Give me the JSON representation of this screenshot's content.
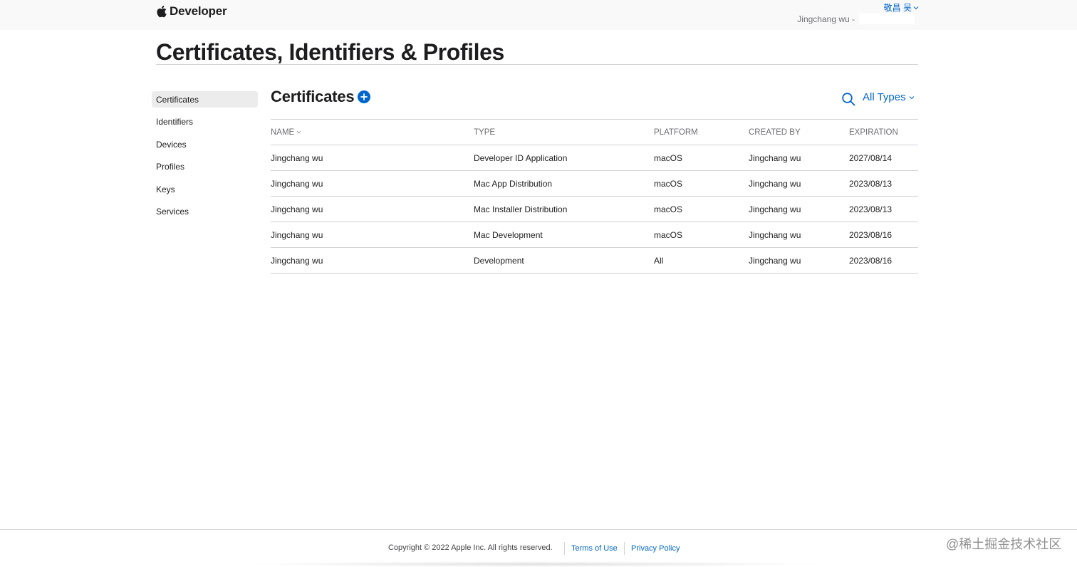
{
  "header": {
    "brand": "Developer",
    "user_name": "敬昌 吴",
    "account_label": "Jingchang wu -"
  },
  "page": {
    "title": "Certificates, Identifiers & Profiles"
  },
  "sidebar": {
    "items": [
      {
        "label": "Certificates",
        "active": true
      },
      {
        "label": "Identifiers"
      },
      {
        "label": "Devices"
      },
      {
        "label": "Profiles"
      },
      {
        "label": "Keys"
      },
      {
        "label": "Services"
      }
    ]
  },
  "section": {
    "title": "Certificates",
    "filter_label": "All Types"
  },
  "table": {
    "columns": [
      "NAME",
      "TYPE",
      "PLATFORM",
      "CREATED BY",
      "EXPIRATION"
    ],
    "rows": [
      {
        "name": "Jingchang wu",
        "type": "Developer ID Application",
        "platform": "macOS",
        "created_by": "Jingchang wu",
        "expiration": "2027/08/14"
      },
      {
        "name": "Jingchang wu",
        "type": "Mac App Distribution",
        "platform": "macOS",
        "created_by": "Jingchang wu",
        "expiration": "2023/08/13"
      },
      {
        "name": "Jingchang wu",
        "type": "Mac Installer Distribution",
        "platform": "macOS",
        "created_by": "Jingchang wu",
        "expiration": "2023/08/13"
      },
      {
        "name": "Jingchang wu",
        "type": "Mac Development",
        "platform": "macOS",
        "created_by": "Jingchang wu",
        "expiration": "2023/08/16"
      },
      {
        "name": "Jingchang wu",
        "type": "Development",
        "platform": "All",
        "created_by": "Jingchang wu",
        "expiration": "2023/08/16"
      }
    ]
  },
  "footer": {
    "copyright": "Copyright © 2022 Apple Inc. All rights reserved.",
    "terms": "Terms of Use",
    "privacy": "Privacy Policy"
  },
  "watermark": "@稀土掘金技术社区",
  "colors": {
    "accent": "#0066cc",
    "text": "#1d1d1f",
    "muted": "#6e6e73",
    "divider": "#d2d2d7",
    "header_bg": "#f9f9f9",
    "active_item_bg": "#ececec"
  },
  "icons": {
    "logo": "apple-logo-icon",
    "add": "plus-circle-icon",
    "search": "search-icon",
    "dropdown": "chevron-down-icon",
    "sort": "sort-chevron-icon"
  }
}
